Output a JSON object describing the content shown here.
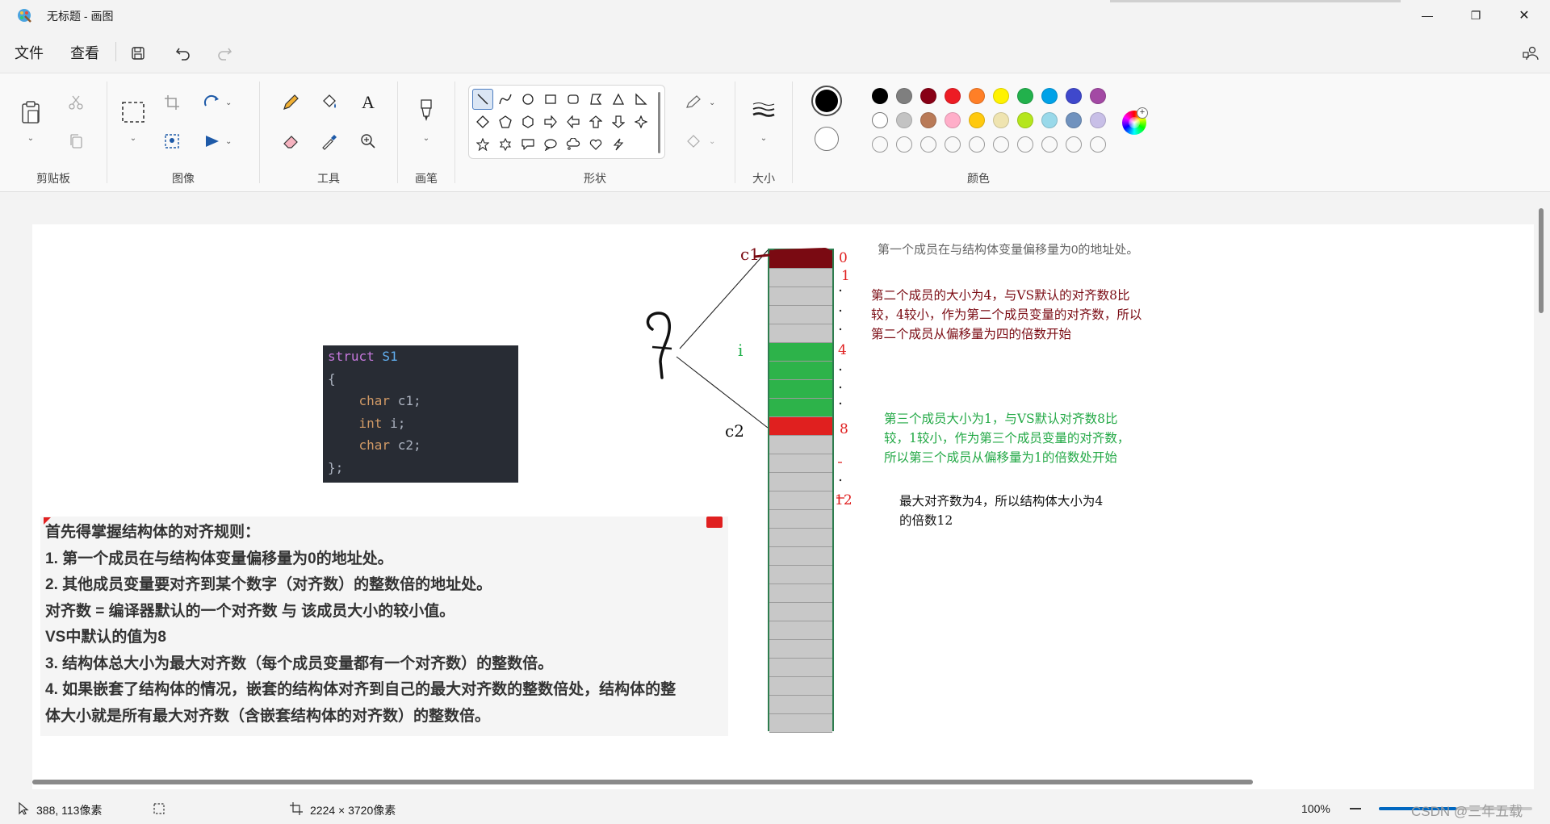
{
  "window": {
    "title": "无标题 - 画图",
    "minimize_glyph": "—",
    "restore_glyph": "❐",
    "close_glyph": "✕"
  },
  "menu": {
    "file": "文件",
    "view": "查看"
  },
  "ribbon": {
    "clipboard_label": "剪贴板",
    "image_label": "图像",
    "tools_label": "工具",
    "brush_label": "画笔",
    "shapes_label": "形状",
    "size_label": "大小",
    "colors_label": "颜色",
    "text_tool_glyph": "A"
  },
  "colors": {
    "primary": "#000000",
    "secondary": "#ffffff",
    "row1": [
      "#000000",
      "#7f7f7f",
      "#880015",
      "#ed1c24",
      "#ff7f27",
      "#fff200",
      "#22b14c",
      "#00a2e8",
      "#3f48cc",
      "#a349a4"
    ],
    "row2": [
      "#ffffff",
      "#c3c3c3",
      "#b97a57",
      "#ffaec9",
      "#ffc90e",
      "#efe4b0",
      "#b5e61d",
      "#99d9ea",
      "#7092be",
      "#c8bfe7"
    ]
  },
  "canvas": {
    "code_lines": {
      "l1_kw": "struct",
      "l1_name": " S1",
      "l2": "{",
      "l3_type": "char",
      "l3_rest": " c1;",
      "l4_type": "int",
      "l4_rest": " i;",
      "l5_type": "char",
      "l5_rest": " c2;",
      "l6": "};"
    },
    "rules": [
      "首先得掌握结构体的对齐规则：",
      "1. 第一个成员在与结构体变量偏移量为0的地址处。",
      "2. 其他成员变量要对齐到某个数字（对齐数）的整数倍的地址处。",
      "对齐数 = 编译器默认的一个对齐数 与 该成员大小的较小值。",
      "VS中默认的值为8",
      "3. 结构体总大小为最大对齐数（每个成员变量都有一个对齐数）的整数倍。",
      "4. 如果嵌套了结构体的情况，嵌套的结构体对齐到自己的最大对齐数的整数倍处，结构体的整",
      "体大小就是所有最大对齐数（含嵌套结构体的对齐数）的整数倍。"
    ],
    "labels": {
      "c1": "c1",
      "i": "i",
      "c2": "c2",
      "offset_0": "0",
      "offset_1": "1",
      "offset_4": "4",
      "offset_8": "8",
      "offset_12": "12"
    },
    "annotation_gray": "第一个成员在与结构体变量偏移量为0的地址处。",
    "annotation_red": [
      "第二个成员的大小为4，与VS默认的对齐数8比",
      "较，4较小，作为第二个成员变量的对齐数，所以",
      "第二个成员从偏移量为四的倍数开始"
    ],
    "annotation_green": [
      "第三个成员大小为1，与VS默认对齐数8比",
      "较，1较小，作为第三个成员变量的对齐数，",
      "所以第三个成员从偏移量为1的倍数处开始"
    ],
    "annotation_black": [
      "最大对齐数为4，所以结构体大小为4",
      "的倍数12"
    ],
    "memory_cells": 26,
    "cell_colors": {
      "c1": "#7a0a12",
      "i": "#2db34a",
      "c2": "#e0201f",
      "empty": "#c8c8c8"
    }
  },
  "status": {
    "cursor_pos": "388, 113像素",
    "canvas_size": "2224 × 3720像素",
    "zoom": "100%",
    "watermark": "CSDN @三年五载"
  }
}
